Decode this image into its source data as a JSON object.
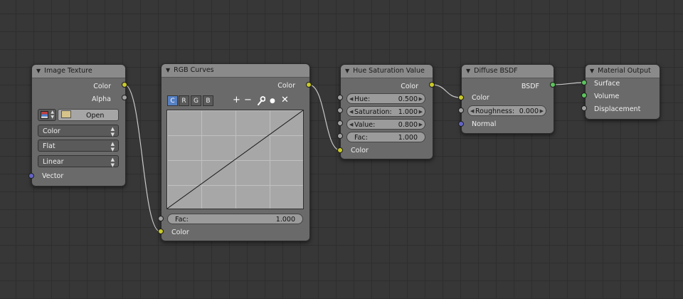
{
  "nodes": {
    "image_texture": {
      "title": "Image Texture",
      "outputs": [
        "Color",
        "Alpha"
      ],
      "open_label": "Open",
      "color_space": "Color",
      "projection": "Flat",
      "interpolation": "Linear",
      "inputs": [
        "Vector"
      ]
    },
    "rgb_curves": {
      "title": "RGB Curves",
      "output": "Color",
      "channels": [
        "C",
        "R",
        "G",
        "B"
      ],
      "active_channel": "C",
      "tools": [
        "+",
        "−",
        "",
        "●",
        "✕"
      ],
      "fac_label": "Fac:",
      "fac_value": "1.000",
      "input_color": "Color"
    },
    "hue_sat": {
      "title": "Hue Saturation Value",
      "output": "Color",
      "fields": [
        {
          "label": "Hue:",
          "value": "0.500"
        },
        {
          "label": "Saturation:",
          "value": "1.000"
        },
        {
          "label": "Value:",
          "value": "0.800"
        },
        {
          "label": "Fac:",
          "value": "1.000"
        }
      ],
      "input_color": "Color"
    },
    "diffuse": {
      "title": "Diffuse BSDF",
      "output": "BSDF",
      "input_color": "Color",
      "roughness_label": "Roughness:",
      "roughness_value": "0.000",
      "input_normal": "Normal"
    },
    "material_output": {
      "title": "Material Output",
      "inputs": [
        "Surface",
        "Volume",
        "Displacement"
      ]
    }
  },
  "colors": {
    "socket_color": "#c9c92a",
    "socket_float": "#a1a1a1",
    "socket_vector": "#6364c6",
    "socket_shader": "#5cc35c",
    "active_channel": "#5680c2"
  }
}
